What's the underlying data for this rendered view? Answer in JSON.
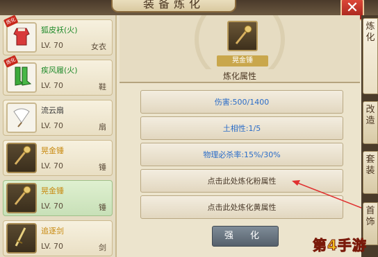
{
  "window": {
    "title": "装备炼化",
    "close_icon": "close-icon"
  },
  "items": [
    {
      "name": "狐皮袄(火)",
      "level": "LV. 70",
      "type": "女衣",
      "badge": "炼化",
      "color": "green",
      "icon": "fur-coat-icon"
    },
    {
      "name": "疾风履(火)",
      "level": "LV. 70",
      "type": "鞋",
      "badge": "炼化",
      "color": "green",
      "icon": "boots-icon"
    },
    {
      "name": "流云扇",
      "level": "LV. 70",
      "type": "扇",
      "badge": "",
      "color": "white",
      "icon": "fan-icon"
    },
    {
      "name": "晃金锤",
      "level": "LV. 70",
      "type": "锤",
      "badge": "",
      "color": "gold",
      "icon": "hammer-icon"
    },
    {
      "name": "晃金锤",
      "level": "LV. 70",
      "type": "锤",
      "badge": "",
      "color": "gold",
      "icon": "hammer-icon",
      "selected": true
    },
    {
      "name": "追逐剑",
      "level": "LV. 70",
      "type": "剑",
      "badge": "",
      "color": "gold",
      "icon": "sword-icon"
    }
  ],
  "equip": {
    "name": "晃金锤",
    "icon": "hammer-icon"
  },
  "section_title": "炼化属性",
  "attributes": [
    {
      "text": "伤害:500/1400",
      "style": "blue"
    },
    {
      "text": "土相性:1/5",
      "style": "blue"
    },
    {
      "text": "物理必杀率:15%/30%",
      "style": "blue"
    },
    {
      "text": "点击此处炼化粉属性",
      "style": "dark"
    },
    {
      "text": "点击此处炼化黄属性",
      "style": "dark"
    }
  ],
  "refine_button": "强 化",
  "side_tabs": [
    {
      "label": "炼\n化",
      "active": true
    },
    {
      "label": "改\n造"
    },
    {
      "label": "套\n装"
    },
    {
      "label": "首\n饰"
    }
  ],
  "watermark": "第4手游",
  "colors": {
    "green_name": "#1f8a2a",
    "gold_name": "#c88a10",
    "attr_blue": "#2a6cc8",
    "button": "#6b7783",
    "close": "#d03a2c"
  }
}
